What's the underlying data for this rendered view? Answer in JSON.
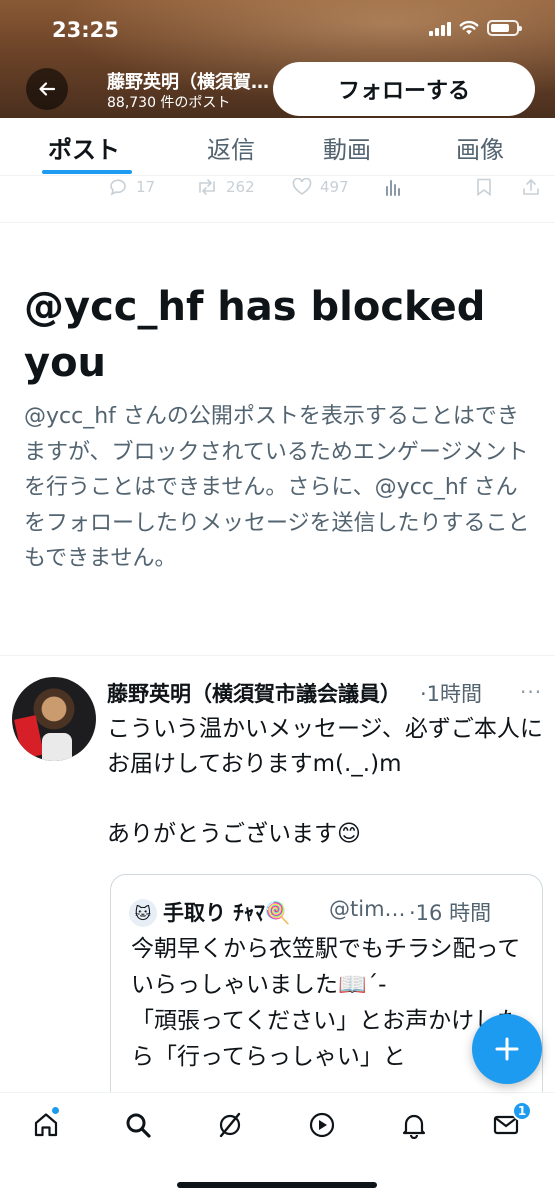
{
  "status_bar": {
    "time": "23:25"
  },
  "header": {
    "title": "藤野英明（横須賀市議会議員)",
    "post_count": "88,730 件のポスト",
    "follow_label": "フォローする"
  },
  "tabs": [
    {
      "label": "ポスト",
      "active": true
    },
    {
      "label": "返信"
    },
    {
      "label": "動画"
    },
    {
      "label": "画像"
    }
  ],
  "faded_actions": {
    "replies": "17",
    "reposts": "262",
    "likes": "497"
  },
  "blocked_notice": {
    "title": "@ycc_hf has blocked you",
    "body": "@ycc_hf さんの公開ポストを表示することはできますが、ブロックされているためエンゲージメントを行うことはできません。さらに、@ycc_hf さんをフォローしたりメッセージを送信したりすることもできません。"
  },
  "post": {
    "author": "藤野英明（横須賀市議会議員）",
    "time": "·1時間",
    "more": "···",
    "text": "こういう温かいメッセージ、必ずご本人にお届けしておりますm(._.)m\n\nありがとうございます😊"
  },
  "quote": {
    "avatar_emoji": "🐱",
    "author": "手取り ﾁｬﾏ🍭",
    "handle": "@timama",
    "time": "·16 時間",
    "text": "今朝早くから衣笠駅でもチラシ配っていらっしゃいました📖´-\n「頑張ってください」とお声かけしたら「行ってらっしゃい」と"
  },
  "bottom_nav": {
    "messages_badge": "1"
  },
  "colors": {
    "accent": "#1d9bf0",
    "text": "#0f1419",
    "muted": "#536471"
  }
}
